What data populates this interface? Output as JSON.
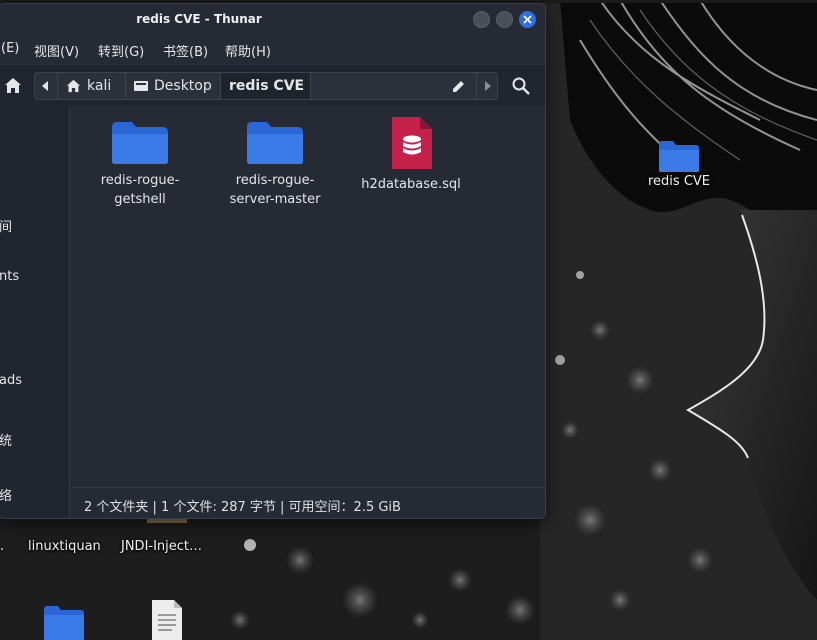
{
  "window": {
    "title": "redis CVE - Thunar"
  },
  "menu": [
    "(E)",
    "视图(V)",
    "转到(G)",
    "书签(B)",
    "帮助(H)"
  ],
  "path": {
    "crumbs": [
      "kali",
      "Desktop",
      "redis CVE"
    ],
    "icons": [
      "home-icon",
      "drive-icon"
    ]
  },
  "sidebar": {
    "items": [
      "间",
      "nts",
      "ads",
      "统",
      "络"
    ]
  },
  "files": [
    {
      "name_line1": "redis-rogue-",
      "name_line2": "getshell",
      "icon": "folder-icon"
    },
    {
      "name_line1": "redis-rogue-",
      "name_line2": "server-master",
      "icon": "folder-icon"
    },
    {
      "name_line1": "h2database.sql",
      "name_line2": "",
      "icon": "database-file-icon"
    }
  ],
  "status": "2 个文件夹 | 1 个文件: 287 字节 | 可用空间：2.5 GiB",
  "desktop": {
    "icons": [
      {
        "label": "redis CVE",
        "icon": "folder-icon"
      },
      {
        "label": ".",
        "icon": ""
      },
      {
        "label": "linuxtiquan",
        "icon": ""
      },
      {
        "label": "JNDI-Inject…",
        "icon": ""
      },
      {
        "label": "",
        "icon": "folder-icon"
      },
      {
        "label": "",
        "icon": "text-file-icon"
      }
    ]
  },
  "colors": {
    "accent": "#2f6de1",
    "folder": "#3a7be8",
    "sql_file": "#c4204a",
    "window_bg": "#262a35"
  }
}
